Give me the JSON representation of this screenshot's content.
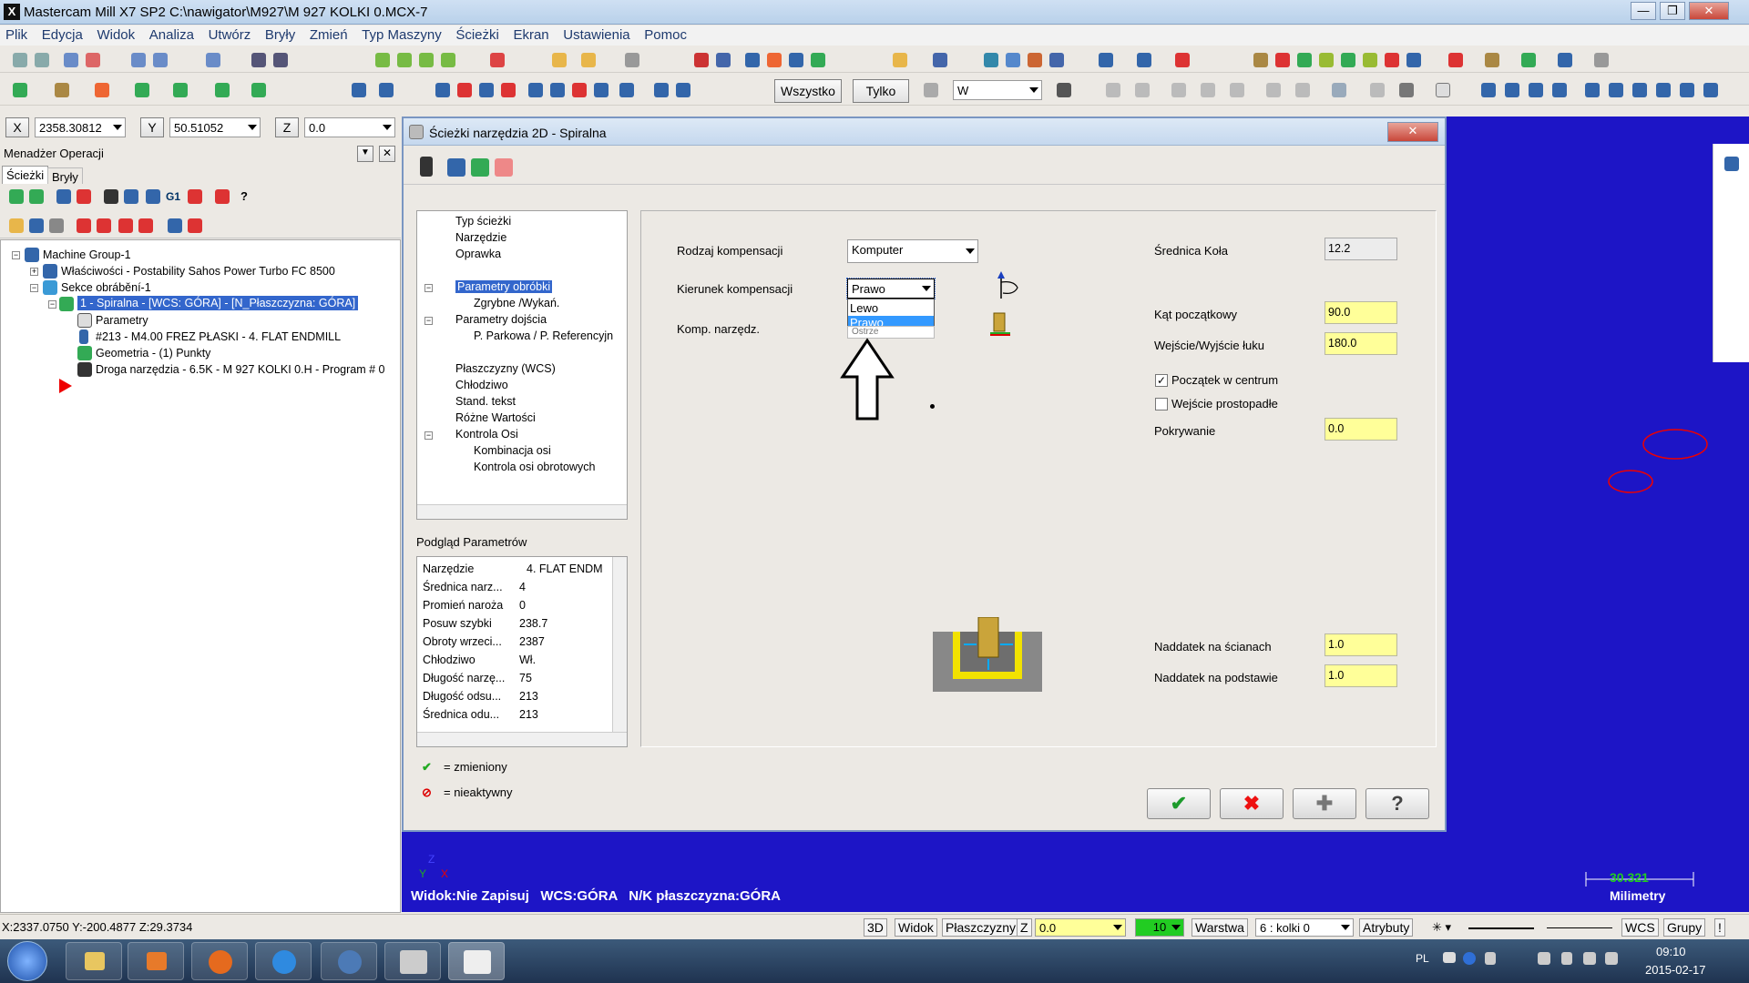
{
  "window": {
    "title": "Mastercam Mill X7 SP2  C:\\nawigator\\M927\\M 927 KOLKI 0.MCX-7",
    "app_icon": "X"
  },
  "menu": [
    "Plik",
    "Edycja",
    "Widok",
    "Analiza",
    "Utwórz",
    "Bryły",
    "Zmień",
    "Typ Maszyny",
    "Ścieżki",
    "Ekran",
    "Ustawienia",
    "Pomoc"
  ],
  "toolbar": {
    "wszystko": "Wszystko",
    "tylko": "Tylko",
    "w_select": "W"
  },
  "coords": {
    "x_label": "X",
    "x_value": "2358.30812",
    "y_label": "Y",
    "y_value": "50.51052",
    "z_label": "Z",
    "z_value": "0.0"
  },
  "ops_manager": {
    "title": "Menadżer Operacji",
    "tabs": [
      "Ścieżki",
      "Bryły"
    ],
    "tree": [
      "Machine Group-1",
      "Właściwości - Postability Sahos Power Turbo FC 8500",
      "Sekce obrábění-1",
      "1 - Spiralna - [WCS: GÓRA] - [N_Płaszczyzna: GÓRA]",
      "Parametry",
      "#213 - M4.00 FREZ PŁASKI -     4. FLAT ENDMILL",
      "Geometria - (1) Punkty",
      "Droga narzędzia - 6.5K - M 927 KOLKI 0.H - Program # 0"
    ]
  },
  "dialog": {
    "title": "Ścieżki narzędzia 2D  - Spiralna",
    "nav": [
      "Typ ścieżki",
      "Narzędzie",
      "Oprawka",
      "Parametry obróbki",
      "Zgrybne /Wykań.",
      "Parametry dojścia",
      "P. Parkowa / P. Referencyjn",
      "Płaszczyzny (WCS)",
      "Chłodziwo",
      "Stand. tekst",
      "Różne Wartości",
      "Kontrola Osi",
      "Kombinacja osi",
      "Kontrola osi obrotowych"
    ],
    "preview_title": "Podgląd Parametrów",
    "preview": [
      {
        "k": "Narzędzie",
        "v": "4. FLAT ENDM"
      },
      {
        "k": "Średnica narz...",
        "v": "4"
      },
      {
        "k": "Promień naroża",
        "v": "0"
      },
      {
        "k": "Posuw szybki",
        "v": "238.7"
      },
      {
        "k": "Obroty wrzeci...",
        "v": "2387"
      },
      {
        "k": "Chłodziwo",
        "v": "Wł."
      },
      {
        "k": "Długość narzę...",
        "v": "75"
      },
      {
        "k": "Długość odsu...",
        "v": "213"
      },
      {
        "k": "Średnica odu...",
        "v": "213"
      }
    ],
    "legend_changed": "= zmieniony",
    "legend_inactive": "= nieaktywny",
    "rodzaj_label": "Rodzaj kompensacji",
    "rodzaj_value": "Komputer",
    "kierunek_label": "Kierunek kompensacji",
    "kierunek_value": "Prawo",
    "kierunek_options": [
      "Lewo",
      "Prawo"
    ],
    "komp_label": "Komp. narzędz.",
    "komp_value": "Ostrze",
    "srednica_label": "Średnica Koła",
    "srednica_value": "12.2",
    "kat_label": "Kąt początkowy",
    "kat_value": "90.0",
    "wejscie_label": "Wejście/Wyjście łuku",
    "wejscie_value": "180.0",
    "poczatek_label": "Początek w centrum",
    "poczatek_checked": true,
    "prostopadle_label": "Wejście prostopadłe",
    "prostopadle_checked": false,
    "pokrywanie_label": "Pokrywanie",
    "pokrywanie_value": "0.0",
    "naddatek_sciany_label": "Naddatek na ścianach",
    "naddatek_sciany_value": "1.0",
    "naddatek_podstawa_label": "Naddatek na podstawie",
    "naddatek_podstawa_value": "1.0",
    "btn_ok": "✔",
    "btn_cancel": "✖",
    "btn_add": "✚",
    "btn_help": "?"
  },
  "viewport": {
    "status": "Widok:Nie Zapisuj   WCS:GÓRA   N/K płaszczyzna:GÓRA",
    "scale_value": "30.321",
    "scale_unit": "Milimetry"
  },
  "status_bar": {
    "coords": "X:2337.0750  Y:-200.4877  Z:29.3734",
    "b3d": "3D",
    "widok": "Widok",
    "plaszczyzny": "Płaszczyzny",
    "z": "Z",
    "z_value": "0.0",
    "level": "10",
    "warstwa": "Warstwa",
    "warstwa_value": "6 : kolki 0",
    "atrybuty": "Atrybuty",
    "wcs": "WCS",
    "grupy": "Grupy"
  },
  "taskbar": {
    "lang": "PL",
    "time": "09:10",
    "date": "2015-02-17"
  }
}
